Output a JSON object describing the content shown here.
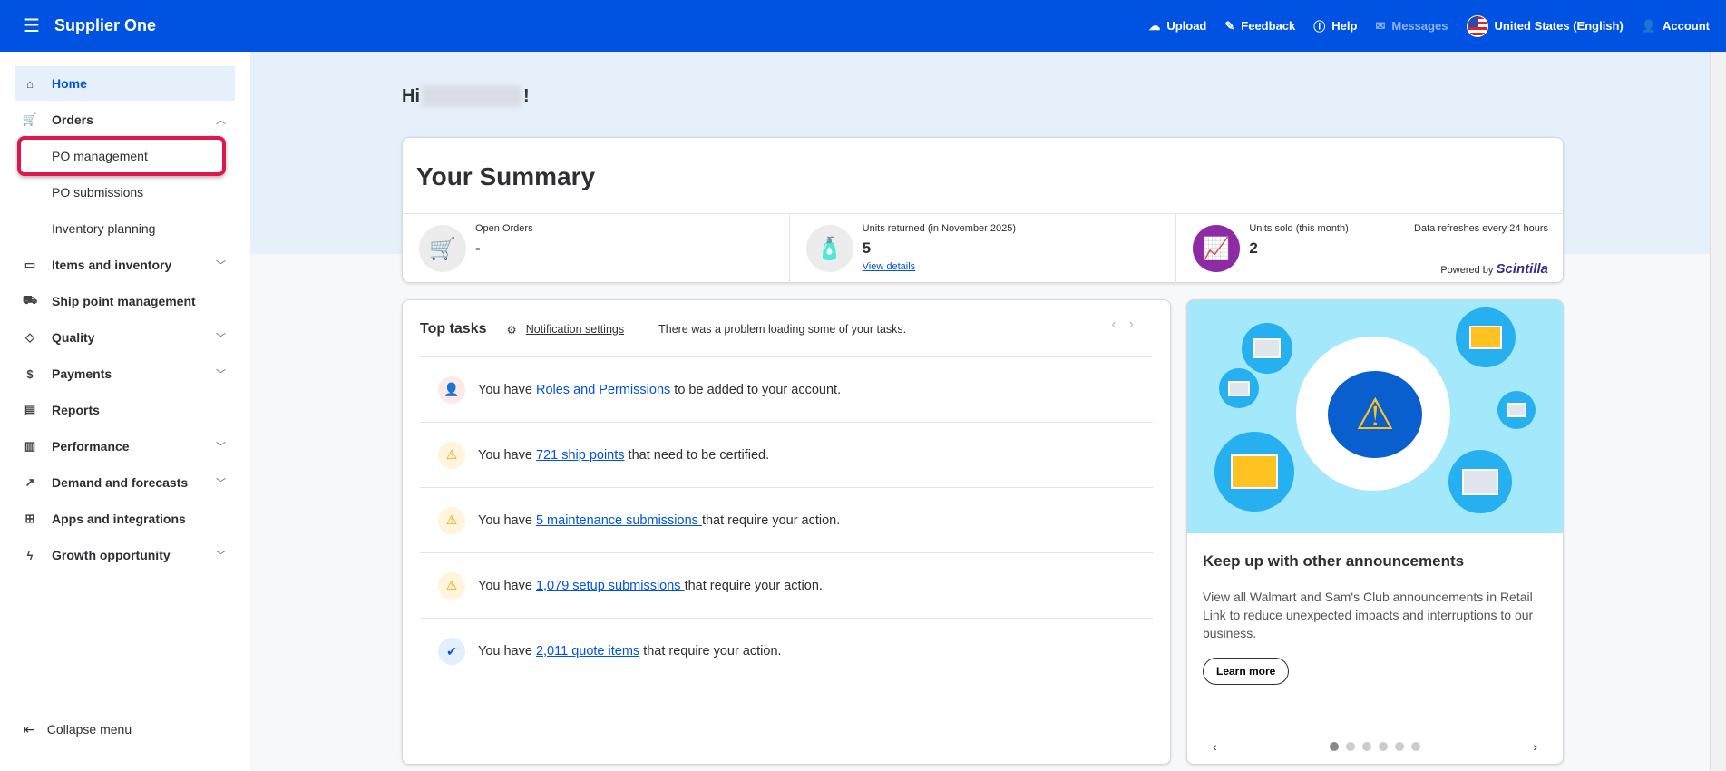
{
  "header": {
    "brand": "Supplier One",
    "upload": "Upload",
    "feedback": "Feedback",
    "help": "Help",
    "messages": "Messages",
    "locale": "United States (English)",
    "account": "Account"
  },
  "sidebar": {
    "items": [
      {
        "label": "Home",
        "icon": "home-icon"
      },
      {
        "label": "Orders",
        "icon": "cart-icon"
      },
      {
        "label": "PO management"
      },
      {
        "label": "PO submissions"
      },
      {
        "label": "Inventory planning"
      },
      {
        "label": "Items and inventory",
        "icon": "box-icon"
      },
      {
        "label": "Ship point management",
        "icon": "truck-icon"
      },
      {
        "label": "Quality",
        "icon": "diamond-icon"
      },
      {
        "label": "Payments",
        "icon": "dollar-icon"
      },
      {
        "label": "Reports",
        "icon": "report-icon"
      },
      {
        "label": "Performance",
        "icon": "bar-chart-icon"
      },
      {
        "label": "Demand and forecasts",
        "icon": "trend-icon"
      },
      {
        "label": "Apps and integrations",
        "icon": "apps-icon"
      },
      {
        "label": "Growth opportunity",
        "icon": "bolt-icon"
      }
    ],
    "collapse": "Collapse menu"
  },
  "greeting": {
    "prefix": "Hi",
    "suffix": "!"
  },
  "summary": {
    "title": "Your Summary",
    "open_orders_label": "Open Orders",
    "open_orders_value": "-",
    "returned_label": "Units returned (in November 2025)",
    "returned_value": "5",
    "view_details": "View details",
    "sold_label": "Units sold (this month)",
    "sold_value": "2",
    "refresh": "Data refreshes every 24 hours",
    "powered_by": "Powered by",
    "powered_brand": "Scintilla"
  },
  "tasks": {
    "title": "Top tasks",
    "notification_settings": "Notification settings",
    "error": "There was a problem loading some of your tasks.",
    "items": [
      {
        "pre": "You have ",
        "link": "Roles and Permissions",
        "post": " to be added to your account."
      },
      {
        "pre": "You have ",
        "link": "721 ship points",
        "post": " that need to be certified."
      },
      {
        "pre": "You have ",
        "link": "5 maintenance submissions ",
        "post": "that require your action."
      },
      {
        "pre": "You have ",
        "link": "1,079 setup submissions ",
        "post": "that require your action."
      },
      {
        "pre": "You have ",
        "link": "2,011 quote items",
        "post": " that require your action."
      }
    ]
  },
  "announcement": {
    "title": "Keep up with other announcements",
    "body": "View all Walmart and Sam's Club announcements in Retail Link to reduce unexpected impacts and interruptions to our business.",
    "button": "Learn more",
    "slide_index": 1,
    "slide_count": 6
  }
}
